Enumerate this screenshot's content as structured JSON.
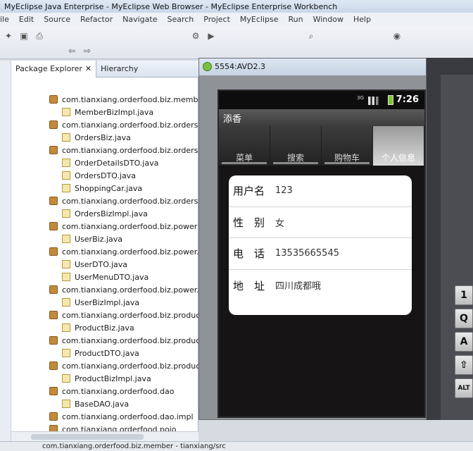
{
  "window": {
    "title": "MyEclipse Java Enterprise - MyEclipse Web Browser - MyEclipse Enterprise Workbench"
  },
  "menu": [
    "ile",
    "Edit",
    "Source",
    "Refactor",
    "Navigate",
    "Search",
    "Project",
    "MyEclipse",
    "Run",
    "Window",
    "Help"
  ],
  "toolbar": {
    "icons": [
      "new-icon",
      "save-icon",
      "print-icon",
      "debug-icon",
      "run-icon",
      "search-icon",
      "browser-icon",
      "back-icon",
      "forward-icon"
    ]
  },
  "explorer": {
    "tabs": [
      {
        "label": "Package Explorer",
        "close": "✕"
      },
      {
        "label": "Hierarchy"
      }
    ],
    "rows": [
      {
        "type": "pkg",
        "label": "com.tianxiang.orderfood.biz.membe"
      },
      {
        "type": "file",
        "label": "MemberBizImpl.java"
      },
      {
        "type": "pkg",
        "label": "com.tianxiang.orderfood.biz.orders"
      },
      {
        "type": "file",
        "label": "OrdersBiz.java"
      },
      {
        "type": "pkg",
        "label": "com.tianxiang.orderfood.biz.orders.c"
      },
      {
        "type": "file",
        "label": "OrderDetailsDTO.java"
      },
      {
        "type": "file",
        "label": "OrdersDTO.java"
      },
      {
        "type": "file",
        "label": "ShoppingCar.java"
      },
      {
        "type": "pkg",
        "label": "com.tianxiang.orderfood.biz.orders.i"
      },
      {
        "type": "file",
        "label": "OrdersBizImpl.java"
      },
      {
        "type": "pkg",
        "label": "com.tianxiang.orderfood.biz.power"
      },
      {
        "type": "file",
        "label": "UserBiz.java"
      },
      {
        "type": "pkg",
        "label": "com.tianxiang.orderfood.biz.power.c"
      },
      {
        "type": "file",
        "label": "UserDTO.java"
      },
      {
        "type": "file",
        "label": "UserMenuDTO.java"
      },
      {
        "type": "pkg",
        "label": "com.tianxiang.orderfood.biz.power.i"
      },
      {
        "type": "file",
        "label": "UserBizImpl.java"
      },
      {
        "type": "pkg",
        "label": "com.tianxiang.orderfood.biz.product"
      },
      {
        "type": "file",
        "label": "ProductBiz.java"
      },
      {
        "type": "pkg",
        "label": "com.tianxiang.orderfood.biz.product"
      },
      {
        "type": "file",
        "label": "ProductDTO.java"
      },
      {
        "type": "pkg",
        "label": "com.tianxiang.orderfood.biz.product"
      },
      {
        "type": "file",
        "label": "ProductBizImpl.java"
      },
      {
        "type": "pkg",
        "label": "com.tianxiang.orderfood.dao"
      },
      {
        "type": "file",
        "label": "BaseDAO.java"
      },
      {
        "type": "pkg",
        "label": "com.tianxiang.orderfood.dao.impl"
      },
      {
        "type": "pkg",
        "label": "com.tianxiang.orderfood.pojo"
      }
    ]
  },
  "emulator": {
    "title": "5554:AVD2.3",
    "clock": "7:26",
    "network": "3G",
    "app_title": "添香",
    "tabs": [
      "菜单",
      "搜索",
      "购物车",
      "个人信息"
    ],
    "selected_tab": "个人信息",
    "fields": [
      {
        "label": "用户名",
        "value": "123"
      },
      {
        "label": "性　别",
        "value": "女"
      },
      {
        "label": "电　话",
        "value": "13535665545"
      },
      {
        "label": "地　址",
        "value": "四川成都哦"
      }
    ],
    "keyboard": [
      "1",
      "Q",
      "A",
      "⇧",
      "ALT"
    ]
  },
  "statusbar": {
    "text": "com.tianxiang.orderfood.biz.member - tianxiang/src"
  }
}
